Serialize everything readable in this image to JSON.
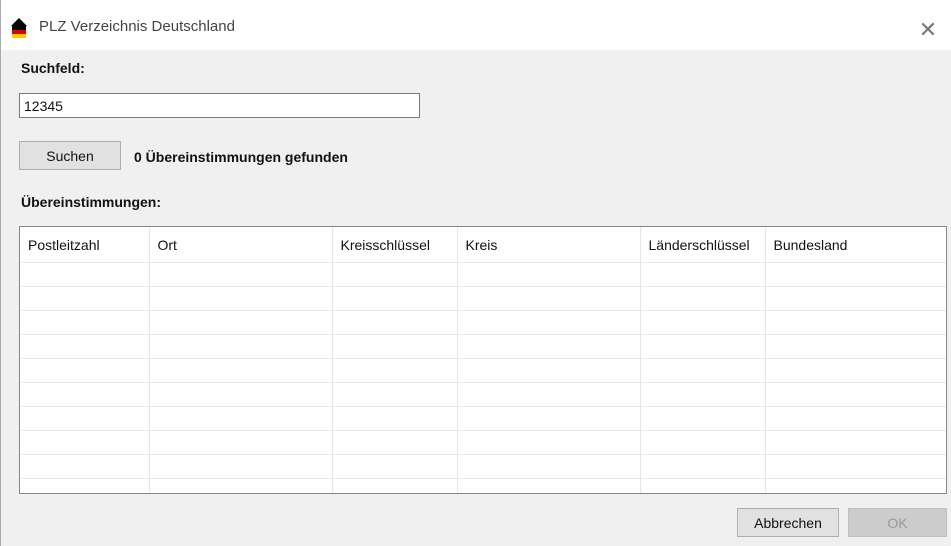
{
  "window": {
    "title": "PLZ Verzeichnis Deutschland",
    "close_glyph": "✕"
  },
  "search": {
    "label": "Suchfeld:",
    "value": "12345",
    "button_label": "Suchen",
    "result_text": "0 Übereinstimmungen gefunden"
  },
  "matches": {
    "label": "Übereinstimmungen:",
    "columns": [
      "Postleitzahl",
      "Ort",
      "Kreisschlüssel",
      "Kreis",
      "Länderschlüssel",
      "Bundesland"
    ],
    "rows": []
  },
  "footer": {
    "cancel_label": "Abbrechen",
    "ok_label": "OK"
  },
  "icons": {
    "app_icon": "germany-flag-house-icon",
    "close_icon": "close-icon"
  },
  "colors": {
    "flag_black": "#000000",
    "flag_red": "#dd0000",
    "flag_gold": "#ffce00",
    "window_bg": "#f0f0f0",
    "disabled_text": "#9a9a9a"
  }
}
